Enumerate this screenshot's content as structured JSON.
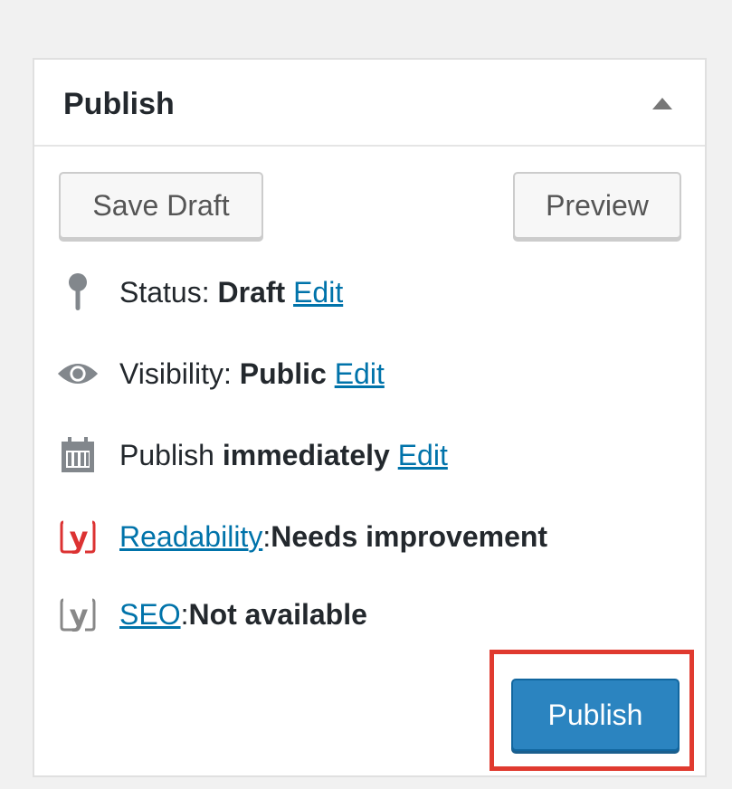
{
  "panel": {
    "title": "Publish"
  },
  "actions": {
    "save_draft_label": "Save Draft",
    "preview_label": "Preview",
    "publish_label": "Publish"
  },
  "status": {
    "prefix": "Status: ",
    "value": "Draft",
    "edit_label": "Edit",
    "icon": "pin-icon"
  },
  "visibility": {
    "prefix": "Visibility: ",
    "value": "Public",
    "edit_label": "Edit",
    "icon": "eye-icon"
  },
  "schedule": {
    "prefix": "Publish ",
    "value": "immediately",
    "edit_label": "Edit",
    "icon": "calendar-icon"
  },
  "readability": {
    "link_label": "Readability",
    "separator": ": ",
    "value": "Needs improvement",
    "icon": "yoast-red-icon",
    "icon_color": "#dc3232"
  },
  "seo": {
    "link_label": "SEO",
    "separator": ": ",
    "value": "Not available",
    "icon": "yoast-gray-icon",
    "icon_color": "#888888"
  },
  "colors": {
    "link": "#0073aa",
    "primary_button": "#2b84c0",
    "highlight": "#e03a2f"
  }
}
